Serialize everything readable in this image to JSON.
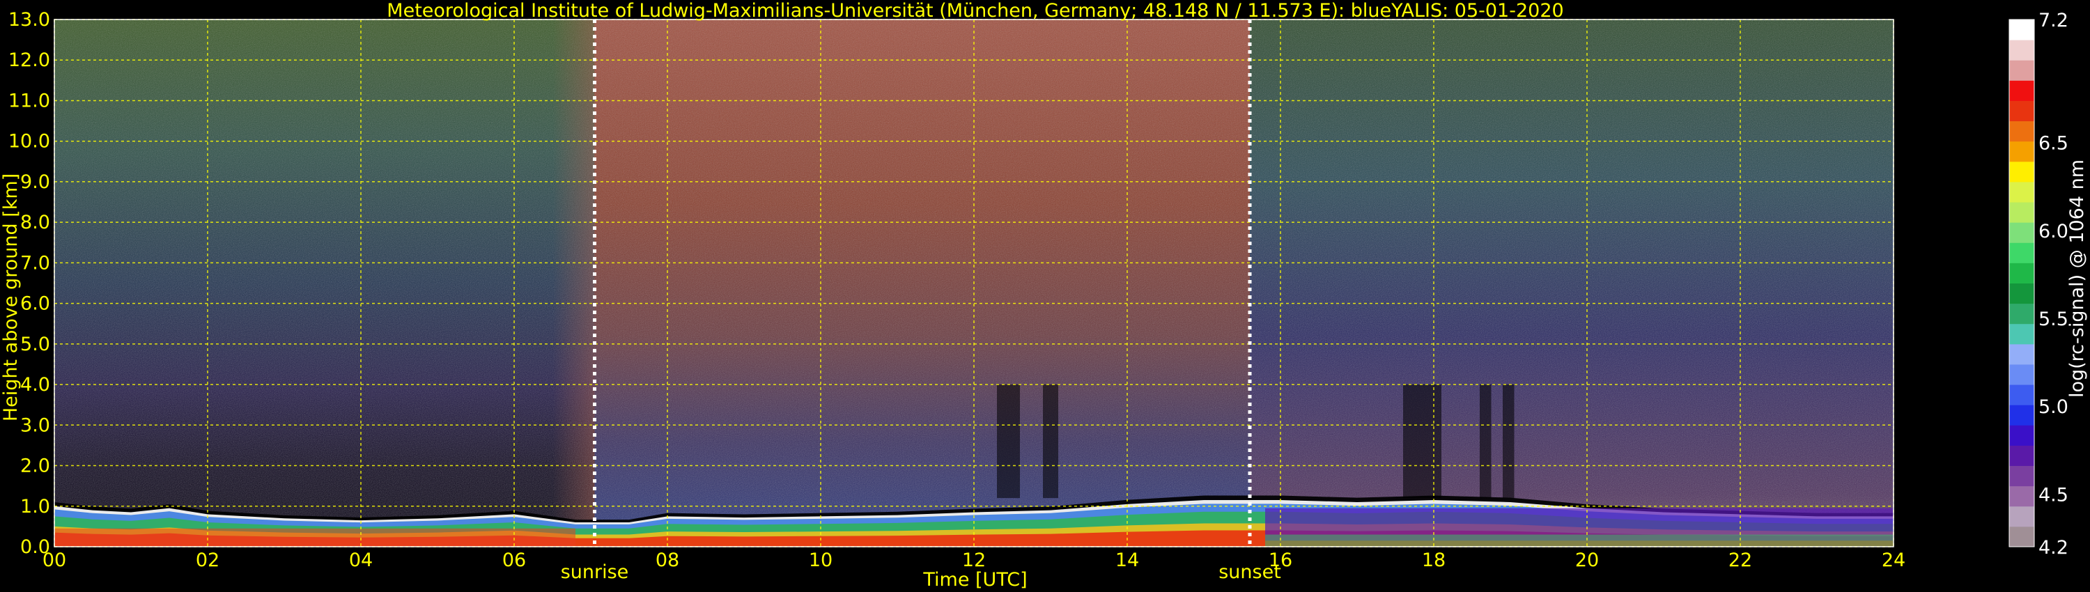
{
  "chart_data": {
    "type": "heatmap",
    "title": "Meteorological Institute of Ludwig-Maximilians-Universität (München, Germany; 48.148 N / 11.573 E):    blueYALIS: 05-01-2020",
    "xlabel": "Time [UTC]",
    "ylabel": "Height above ground [km]",
    "xlim": [
      0,
      24
    ],
    "ylim": [
      0,
      13
    ],
    "x_ticks": [
      "00",
      "02",
      "04",
      "06",
      "08",
      "10",
      "12",
      "14",
      "16",
      "18",
      "20",
      "22",
      "24"
    ],
    "y_ticks": [
      "0.0",
      "1.0",
      "2.0",
      "3.0",
      "4.0",
      "5.0",
      "6.0",
      "7.0",
      "8.0",
      "9.0",
      "10.0",
      "11.0",
      "12.0",
      "13.0"
    ],
    "grid": true,
    "markers": [
      {
        "label": "sunrise",
        "x": 7.05
      },
      {
        "label": "sunset",
        "x": 15.6
      }
    ],
    "colorbar": {
      "label": "log(rc-signal) @ 1064 nm",
      "range": [
        4.2,
        7.2
      ],
      "ticks": [
        "4.2",
        "4.5",
        "5.0",
        "5.5",
        "6.0",
        "6.5",
        "7.2"
      ],
      "colors": [
        "#a08f96",
        "#b7a3bd",
        "#9a6aa8",
        "#7a3fa0",
        "#5a1aa8",
        "#3a10c8",
        "#2030e8",
        "#3d5cf0",
        "#6a8cf5",
        "#93aef8",
        "#4dc7b2",
        "#2faa6a",
        "#14963c",
        "#1fb848",
        "#3ed868",
        "#7ee07a",
        "#b8ec60",
        "#dcf248",
        "#ffee00",
        "#f5a000",
        "#ed7010",
        "#e83410",
        "#f01010",
        "#e0a0a0",
        "#f0d0d0",
        "#ffffff"
      ]
    },
    "boundary_layer_top": [
      {
        "t": 0,
        "h": 1.0
      },
      {
        "t": 0.5,
        "h": 0.9
      },
      {
        "t": 1,
        "h": 0.85
      },
      {
        "t": 1.5,
        "h": 0.95
      },
      {
        "t": 2,
        "h": 0.8
      },
      {
        "t": 3,
        "h": 0.7
      },
      {
        "t": 4,
        "h": 0.65
      },
      {
        "t": 5,
        "h": 0.7
      },
      {
        "t": 6,
        "h": 0.8
      },
      {
        "t": 6.8,
        "h": 0.6
      },
      {
        "t": 7.5,
        "h": 0.6
      },
      {
        "t": 8,
        "h": 0.75
      },
      {
        "t": 9,
        "h": 0.72
      },
      {
        "t": 10,
        "h": 0.75
      },
      {
        "t": 11,
        "h": 0.78
      },
      {
        "t": 12,
        "h": 0.85
      },
      {
        "t": 13,
        "h": 0.9
      },
      {
        "t": 14,
        "h": 1.05
      },
      {
        "t": 15,
        "h": 1.15
      },
      {
        "t": 16,
        "h": 1.15
      },
      {
        "t": 17,
        "h": 1.1
      },
      {
        "t": 18,
        "h": 1.15
      },
      {
        "t": 19,
        "h": 1.1
      },
      {
        "t": 20,
        "h": 0.95
      },
      {
        "t": 21,
        "h": 0.85
      },
      {
        "t": 22,
        "h": 0.8
      },
      {
        "t": 23,
        "h": 0.75
      },
      {
        "t": 24,
        "h": 0.75
      }
    ]
  }
}
